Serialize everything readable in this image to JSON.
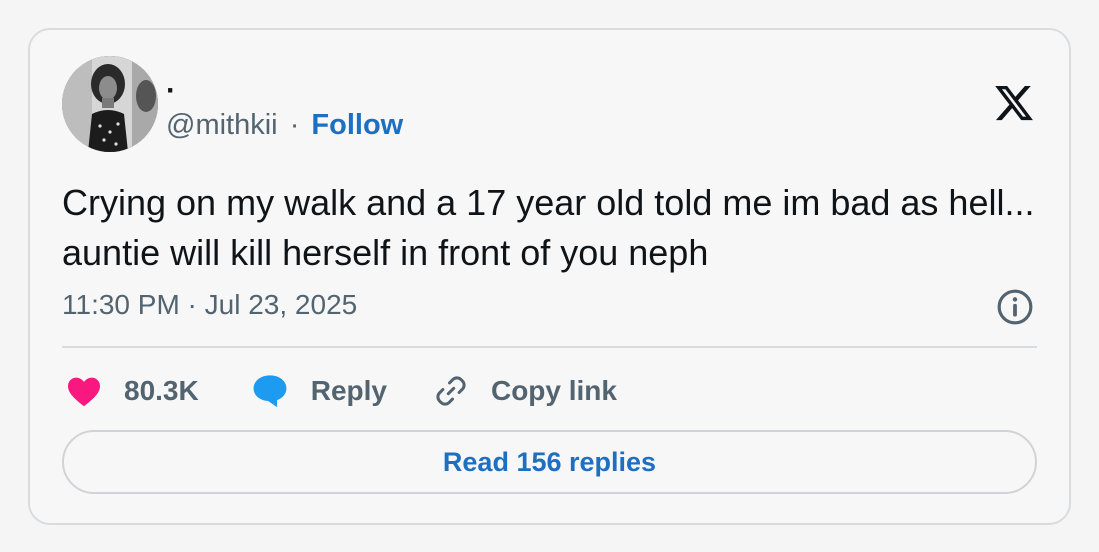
{
  "author": {
    "display_name": "·",
    "handle": "@mithkii",
    "separator": "·",
    "follow_label": "Follow",
    "avatar_icon": "profile-photo"
  },
  "tweet": {
    "text": "Crying on my walk and a 17 year old told me im bad as hell... auntie will kill herself in front of you neph",
    "timestamp": "11:30 PM · Jul 23, 2025"
  },
  "actions": {
    "likes_count": "80.3K",
    "reply_label": "Reply",
    "copy_link_label": "Copy link"
  },
  "read_replies_label": "Read 156 replies",
  "icons": {
    "brand": "x-logo-icon",
    "info": "info-icon",
    "like": "heart-icon",
    "reply": "speech-bubble-icon",
    "copy": "link-icon"
  },
  "colors": {
    "link_blue": "#1d6fc2",
    "heart_pink": "#f91880",
    "reply_blue": "#1d9bf0",
    "muted_text": "#536471"
  }
}
